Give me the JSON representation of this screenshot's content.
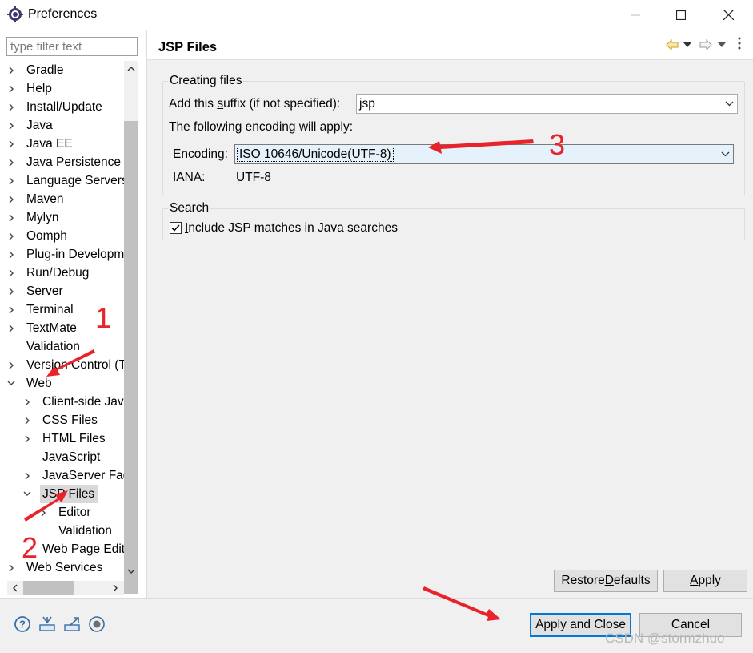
{
  "window": {
    "title": "Preferences",
    "minimize_icon": "minimize-icon",
    "maximize_icon": "maximize-icon",
    "close_icon": "close-icon"
  },
  "filter": {
    "placeholder": "type filter text",
    "value": ""
  },
  "tree": {
    "items": [
      {
        "label": "Gradle",
        "state": "collapsed",
        "level": 0
      },
      {
        "label": "Help",
        "state": "collapsed",
        "level": 0
      },
      {
        "label": "Install/Update",
        "state": "collapsed",
        "level": 0
      },
      {
        "label": "Java",
        "state": "collapsed",
        "level": 0
      },
      {
        "label": "Java EE",
        "state": "collapsed",
        "level": 0
      },
      {
        "label": "Java Persistence",
        "state": "collapsed",
        "level": 0
      },
      {
        "label": "Language Servers",
        "state": "collapsed",
        "level": 0
      },
      {
        "label": "Maven",
        "state": "collapsed",
        "level": 0
      },
      {
        "label": "Mylyn",
        "state": "collapsed",
        "level": 0
      },
      {
        "label": "Oomph",
        "state": "collapsed",
        "level": 0
      },
      {
        "label": "Plug-in Development",
        "state": "collapsed",
        "level": 0
      },
      {
        "label": "Run/Debug",
        "state": "collapsed",
        "level": 0
      },
      {
        "label": "Server",
        "state": "collapsed",
        "level": 0
      },
      {
        "label": "Terminal",
        "state": "collapsed",
        "level": 0
      },
      {
        "label": "TextMate",
        "state": "collapsed",
        "level": 0
      },
      {
        "label": "Validation",
        "state": "leaf",
        "level": 0
      },
      {
        "label": "Version Control (Team)",
        "state": "collapsed",
        "level": 0
      },
      {
        "label": "Web",
        "state": "expanded",
        "level": 0
      },
      {
        "label": "Client-side JavaScript",
        "state": "collapsed",
        "level": 1
      },
      {
        "label": "CSS Files",
        "state": "collapsed",
        "level": 1
      },
      {
        "label": "HTML Files",
        "state": "collapsed",
        "level": 1
      },
      {
        "label": "JavaScript",
        "state": "leaf",
        "level": 1
      },
      {
        "label": "JavaServer Faces Tools",
        "state": "collapsed",
        "level": 1
      },
      {
        "label": "JSP Files",
        "state": "expanded",
        "level": 1,
        "selected": true
      },
      {
        "label": "Editor",
        "state": "collapsed",
        "level": 2
      },
      {
        "label": "Validation",
        "state": "leaf",
        "level": 2
      },
      {
        "label": "Web Page Editor",
        "state": "leaf",
        "level": 1
      },
      {
        "label": "Web Services",
        "state": "collapsed",
        "level": 0
      }
    ]
  },
  "page": {
    "title": "JSP Files",
    "back_icon": "back-arrow-icon",
    "forward_icon": "forward-arrow-icon",
    "menu_icon": "view-menu-icon"
  },
  "creating_files": {
    "group_title": "Creating files",
    "suffix_label_pre": "Add this ",
    "suffix_label_mnemonic": "s",
    "suffix_label_post": "uffix (if not specified):",
    "suffix_value": "jsp",
    "encoding_intro": "The following encoding will apply:",
    "encoding_label_pre": "En",
    "encoding_label_mnemonic": "c",
    "encoding_label_post": "oding:",
    "encoding_value": "ISO 10646/Unicode(UTF-8)",
    "iana_label": "IANA:",
    "iana_value": "UTF-8"
  },
  "search": {
    "group_title": "Search",
    "checkbox_label_pre": "",
    "checkbox_label_mnemonic": "I",
    "checkbox_label_post": "nclude JSP matches in Java searches",
    "checked": true
  },
  "buttons": {
    "restore_pre": "Restore ",
    "restore_mnemonic": "D",
    "restore_post": "efaults",
    "apply_pre": "",
    "apply_mnemonic": "A",
    "apply_post": "pply",
    "apply_close": "Apply and Close",
    "cancel": "Cancel"
  },
  "bottom_icons": [
    "help-icon",
    "import-icon",
    "export-icon",
    "record-icon"
  ],
  "annotations": [
    "1",
    "2",
    "3"
  ],
  "watermark": "CSDN @stormzhuo",
  "colors": {
    "annotation": "#e8232a",
    "default_button_border": "#0078d7",
    "selection": "#d9d9d9"
  }
}
